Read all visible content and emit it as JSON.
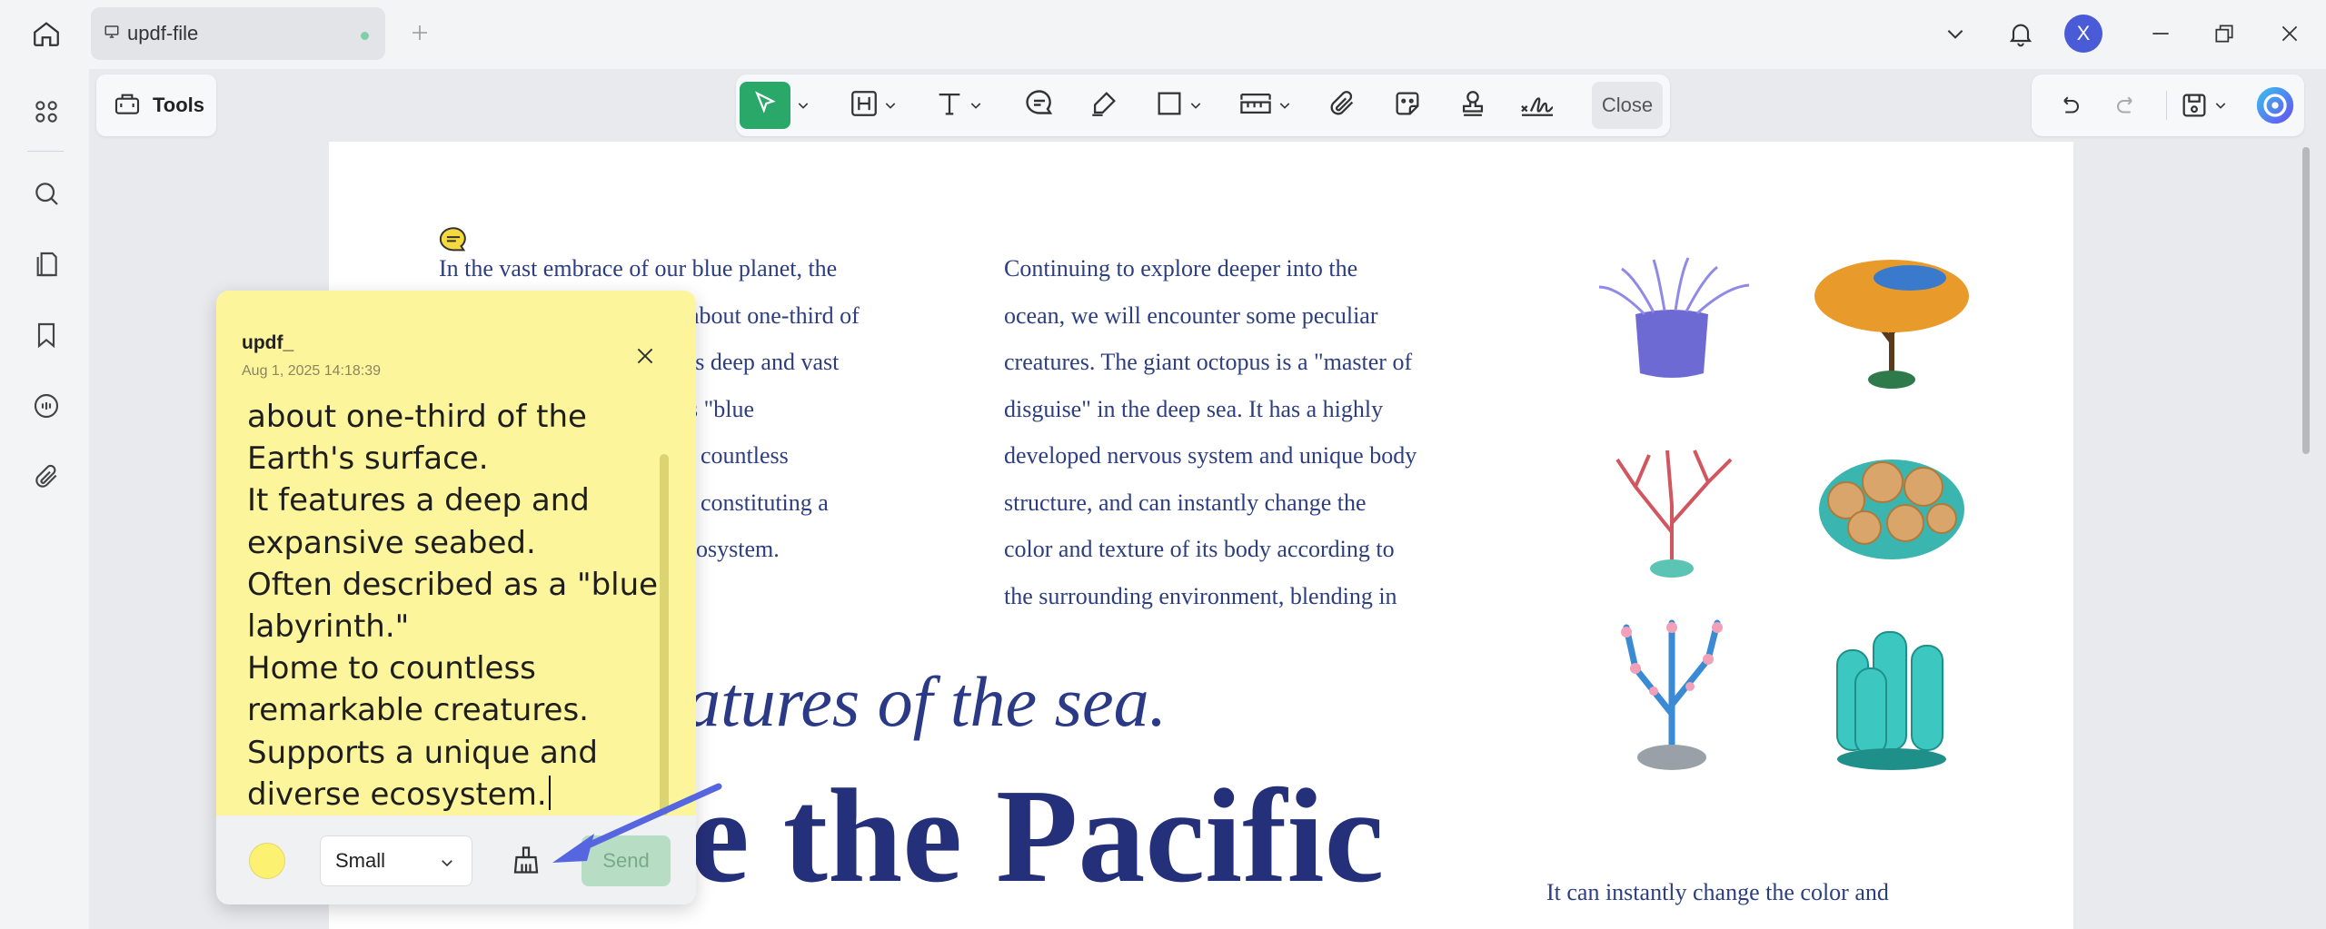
{
  "tab": {
    "title": "updf-file"
  },
  "user": {
    "initial": "X"
  },
  "toolbar": {
    "tools_label": "Tools",
    "close_label": "Close"
  },
  "document": {
    "column1": [
      "In the vast embrace of our blue planet, the",
      "about one-third of",
      "ts deep and vast",
      "s \"blue",
      "countless",
      "constituting a",
      "osystem."
    ],
    "column2": [
      "Continuing to explore deeper into the",
      "ocean, we will encounter some peculiar",
      "creatures. The giant octopus is a \"master of",
      "disguise\" in the deep sea. It has a highly",
      "developed nervous system and unique body",
      "structure, and can instantly change the",
      "color and texture of its body according to",
      "the surrounding environment, blending in"
    ],
    "subtitle": "reatures of the sea.",
    "title": "ore the Pacific",
    "right_caption": "It can instantly change the color and"
  },
  "note": {
    "author": "updf_",
    "date": "Aug 1, 2025 14:18:39",
    "lines": [
      "about one-third of the",
      "Earth's surface.",
      "It features a deep and",
      "expansive seabed.",
      "Often described as a \"blue",
      "labyrinth.\"",
      "Home to countless",
      "remarkable creatures.",
      "Supports a unique and",
      "diverse ecosystem."
    ],
    "font_size": "Small",
    "send_label": "Send",
    "color": "#fdf171"
  },
  "colors": {
    "accent": "#29a86a",
    "note_bg": "#fdf59b",
    "text_blue": "#2c3e80"
  }
}
